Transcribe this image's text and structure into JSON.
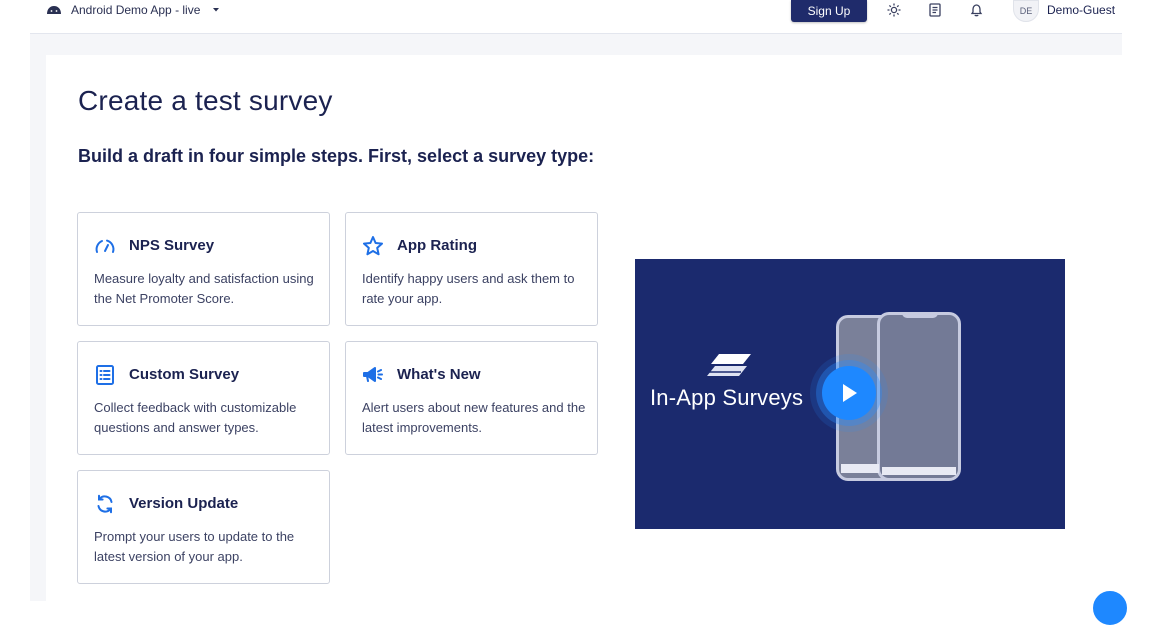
{
  "header": {
    "app_name": "Android Demo App - live",
    "signup_label": "Sign Up",
    "avatar_initials": "DE",
    "username": "Demo-Guest"
  },
  "main": {
    "title": "Create a test survey",
    "subtitle": "Build a draft in four simple steps. First, select a survey type:"
  },
  "survey_types": [
    {
      "title": "NPS Survey",
      "description": "Measure loyalty and satisfaction using the Net Promoter Score.",
      "icon": "gauge-icon"
    },
    {
      "title": "App Rating",
      "description": "Identify happy users and ask them to rate your app.",
      "icon": "star-icon"
    },
    {
      "title": "Custom Survey",
      "description": "Collect feedback with customizable questions and answer types.",
      "icon": "checklist-icon"
    },
    {
      "title": "What's New",
      "description": "Alert users about new features and the latest improvements.",
      "icon": "megaphone-icon"
    },
    {
      "title": "Version Update",
      "description": "Prompt your users to update to the latest version of your app.",
      "icon": "refresh-icon"
    }
  ],
  "video": {
    "title": "In-App Surveys"
  },
  "colors": {
    "brand_navy": "#1b2250",
    "accent_blue": "#1e88ff",
    "video_bg": "#1b2a6e"
  }
}
